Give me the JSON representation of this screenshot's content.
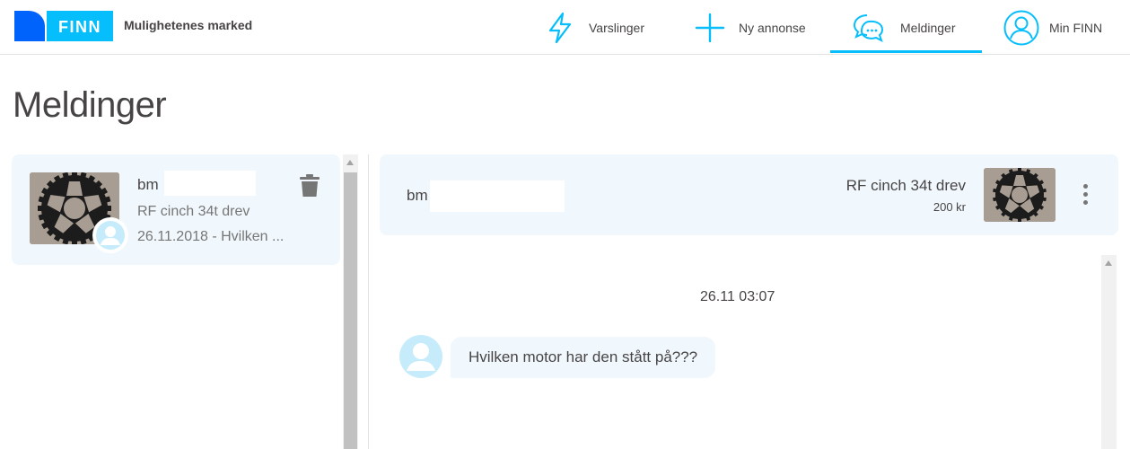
{
  "header": {
    "tagline": "Mulighetenes marked",
    "nav": [
      {
        "label": "Varslinger",
        "icon": "lightning-icon"
      },
      {
        "label": "Ny annonse",
        "icon": "plus-icon"
      },
      {
        "label": "Meldinger",
        "icon": "chat-bubbles-icon",
        "active": true
      },
      {
        "label": "Min FINN",
        "icon": "user-circle-icon"
      }
    ],
    "logo_text": "FINN"
  },
  "page": {
    "title": "Meldinger"
  },
  "conversations": [
    {
      "name": "bm",
      "ad_title": "RF cinch 34t drev",
      "snippet": "26.11.2018 - Hvilken ..."
    }
  ],
  "chat": {
    "name": "bm",
    "ad_title": "RF cinch 34t drev",
    "ad_price": "200 kr",
    "timestamp": "26.11 03:07",
    "messages": [
      {
        "text": "Hvilken motor har den stått på???"
      }
    ]
  },
  "colors": {
    "brand_blue": "#0063fb",
    "accent_cyan": "#06befb",
    "card_bg": "#f1f8fd",
    "text": "#474445"
  }
}
